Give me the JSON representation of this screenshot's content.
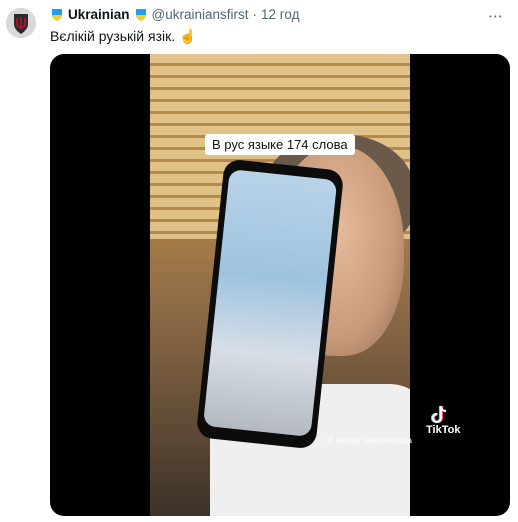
{
  "tweet": {
    "display_name": "Ukrainian",
    "handle": "@ukrainiansfirst",
    "separator": "·",
    "time": "12 год",
    "text": "Вєлікій рузькій язік. ☝️",
    "more_label": "⋯"
  },
  "media": {
    "caption": "В рус языке 174 слова",
    "watermark_brand": "TikTok",
    "watermark_handle": "@ alenka.sestrenka.usa"
  },
  "colors": {
    "accent_text": "#0f1419",
    "muted": "#536471",
    "badge": "#1da1f2"
  },
  "icons": {
    "avatar": "trident-shield-icon",
    "badge": "ukraine-shield-icon",
    "more": "more-icon",
    "tiktok": "tiktok-icon"
  }
}
